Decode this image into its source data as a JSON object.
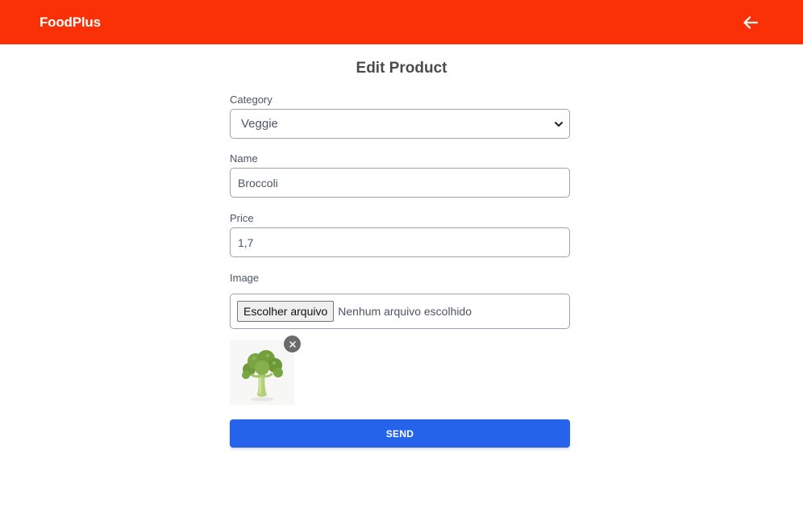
{
  "header": {
    "brand": "FoodPlus",
    "back_icon": "arrow-left-icon",
    "background": "#fa3006"
  },
  "page": {
    "title": "Edit Product"
  },
  "form": {
    "category": {
      "label": "Category",
      "value": "Veggie"
    },
    "name": {
      "label": "Name",
      "value": "Broccoli"
    },
    "price": {
      "label": "Price",
      "value": "1,7"
    },
    "image": {
      "label": "Image",
      "choose_button": "Escolher arquivo",
      "file_status": "Nenhum arquivo escolhido",
      "remove_icon": "close-icon"
    },
    "submit_label": "SEND",
    "submit_color": "#2563eb"
  }
}
